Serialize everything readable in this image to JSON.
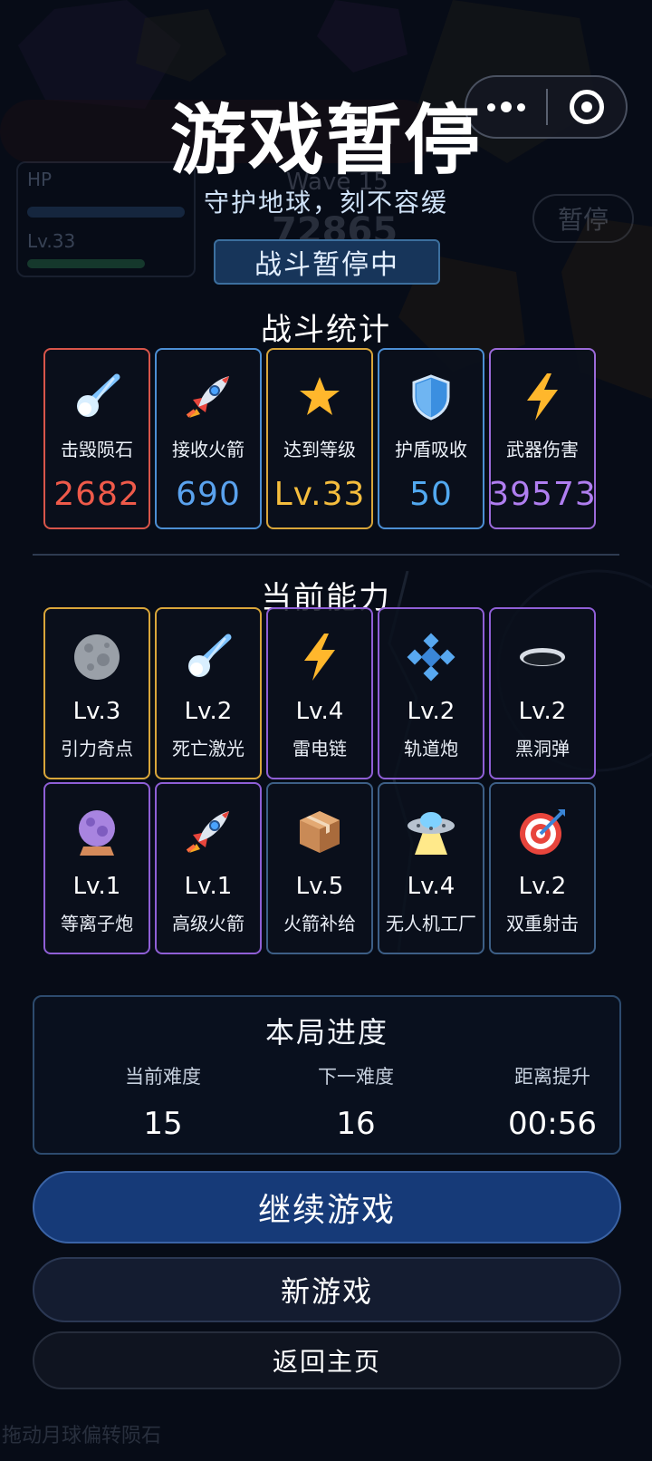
{
  "hud": {
    "hp_label": "HP",
    "level_label": "Lv.33",
    "wave_label": "Wave 15",
    "score": "72865",
    "pause_button": "暂停",
    "hint": "拖动月球偏转陨石"
  },
  "header": {
    "title": "游戏暂停",
    "subtitle": "守护地球，刻不容缓",
    "status": "战斗暂停中"
  },
  "stats": {
    "title": "战斗统计",
    "items": [
      {
        "label": "击毁陨石",
        "value": "2682",
        "color": "#ef5a4a",
        "border": "#d8554a",
        "icon": "comet-icon"
      },
      {
        "label": "接收火箭",
        "value": "690",
        "color": "#5aa2ee",
        "border": "#4c8fd4",
        "icon": "rocket-icon"
      },
      {
        "label": "达到等级",
        "value": "Lv.33",
        "color": "#f5bd3d",
        "border": "#d9a63a",
        "icon": "star-icon"
      },
      {
        "label": "护盾吸收",
        "value": "50",
        "color": "#52a9f0",
        "border": "#4c8fd4",
        "icon": "shield-icon"
      },
      {
        "label": "武器伤害",
        "value": "39573",
        "color": "#b07ef0",
        "border": "#9b6ad9",
        "icon": "lightning-icon"
      }
    ]
  },
  "abilities": {
    "title": "当前能力",
    "items": [
      {
        "level": "Lv.3",
        "name": "引力奇点",
        "border": "#d9a63a",
        "icon": "moon-icon"
      },
      {
        "level": "Lv.2",
        "name": "死亡激光",
        "border": "#d9a63a",
        "icon": "comet-icon"
      },
      {
        "level": "Lv.4",
        "name": "雷电链",
        "border": "#8f5fd6",
        "icon": "lightning-icon"
      },
      {
        "level": "Lv.2",
        "name": "轨道炮",
        "border": "#8f5fd6",
        "icon": "diamond-cluster-icon"
      },
      {
        "level": "Lv.2",
        "name": "黑洞弹",
        "border": "#8f5fd6",
        "icon": "black-hole-icon"
      },
      {
        "level": "Lv.1",
        "name": "等离子炮",
        "border": "#8f5fd6",
        "icon": "crystal-ball-icon"
      },
      {
        "level": "Lv.1",
        "name": "高级火箭",
        "border": "#8f5fd6",
        "icon": "rocket-icon"
      },
      {
        "level": "Lv.5",
        "name": "火箭补给",
        "border": "#3d5f86",
        "icon": "package-icon"
      },
      {
        "level": "Lv.4",
        "name": "无人机工厂",
        "border": "#3d5f86",
        "icon": "ufo-icon"
      },
      {
        "level": "Lv.2",
        "name": "双重射击",
        "border": "#3d5f86",
        "icon": "target-icon"
      }
    ]
  },
  "progress": {
    "title": "本局进度",
    "current_label": "当前难度",
    "current_value": "15",
    "next_label": "下一难度",
    "next_value": "16",
    "countdown_label": "距离提升",
    "countdown_value": "00:56"
  },
  "buttons": {
    "resume": "继续游戏",
    "new_game": "新游戏",
    "home": "返回主页"
  }
}
